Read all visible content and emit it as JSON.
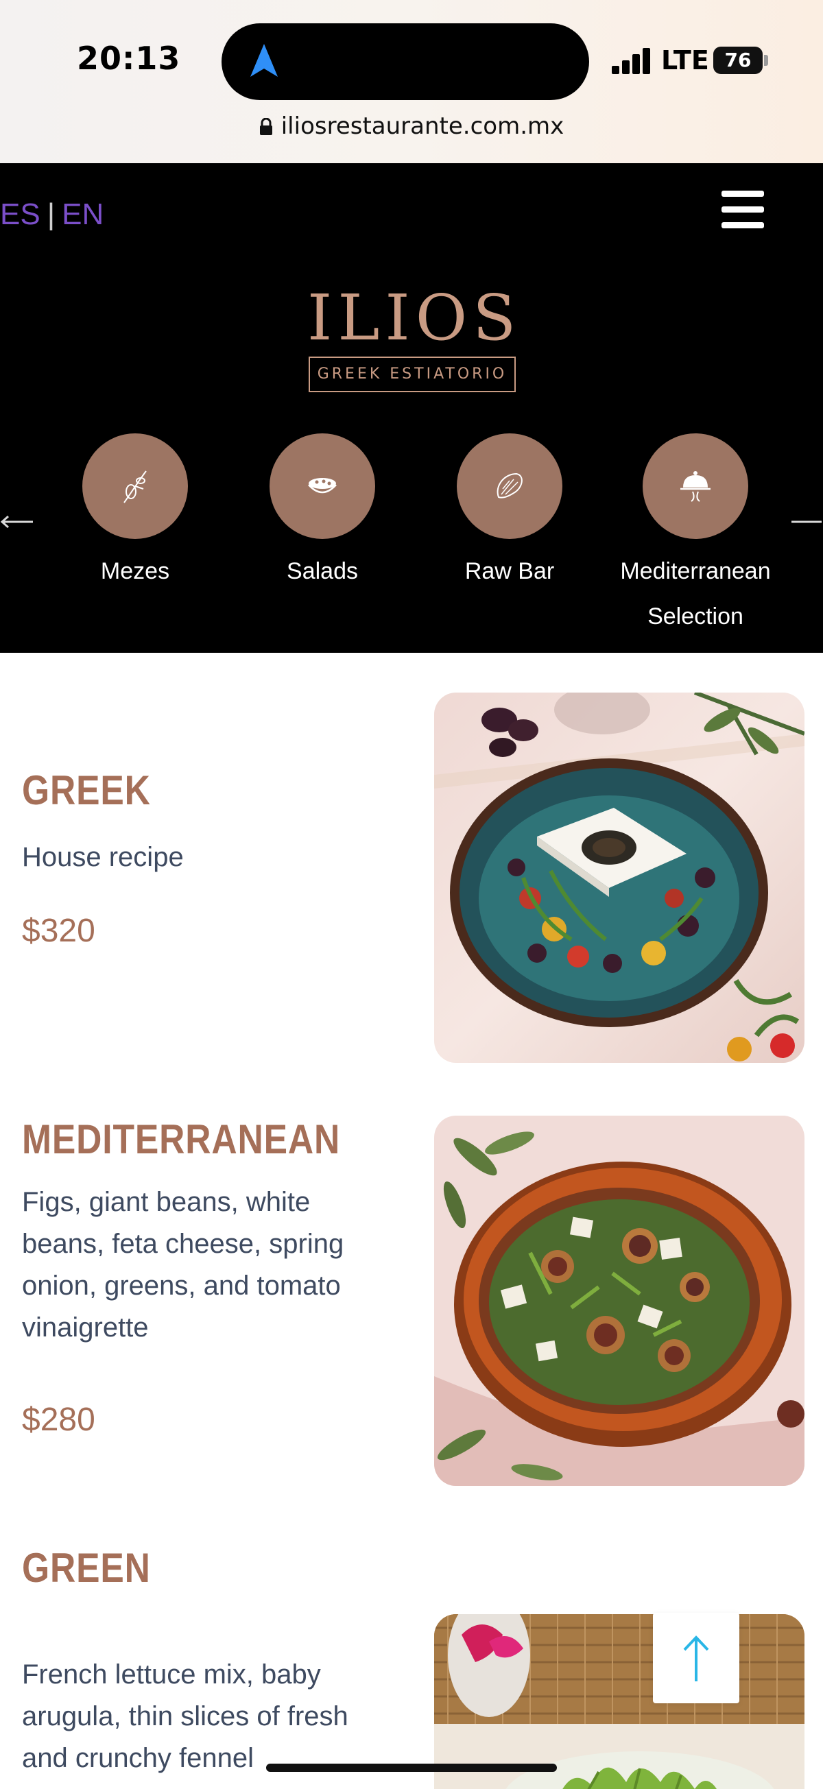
{
  "status_bar": {
    "time": "20:13",
    "network": "LTE",
    "battery": "76"
  },
  "browser": {
    "url": "iliosrestaurante.com.mx"
  },
  "header": {
    "lang_es": "ES",
    "lang_sep": "|",
    "lang_en": "EN",
    "logo_word": "ILIOS",
    "logo_sub": "GREEK ESTIATORIO",
    "categories": [
      {
        "label": "Mezes",
        "icon": "olive-branch-icon"
      },
      {
        "label": "Salads",
        "icon": "salad-bowl-icon"
      },
      {
        "label": "Raw Bar",
        "icon": "oyster-icon"
      },
      {
        "label": "Mediterranean Selection",
        "icon": "cloche-icon"
      }
    ]
  },
  "menu": {
    "items": [
      {
        "title": "GREEK",
        "description": "House recipe",
        "price": "$320"
      },
      {
        "title": "MEDITERRANEAN",
        "description": "Figs, giant beans, white beans, feta cheese, spring onion, greens, and tomato vinaigrette",
        "price": "$280"
      },
      {
        "title": "GREEN",
        "description": "French lettuce mix, baby arugula, thin slices of fresh and crunchy fennel",
        "price": ""
      }
    ]
  },
  "colors": {
    "accent": "#a56f58",
    "circle": "#9d7563",
    "lang": "#7b4fc9",
    "text": "#3e4a60",
    "scroll_top": "#29b6e6"
  }
}
